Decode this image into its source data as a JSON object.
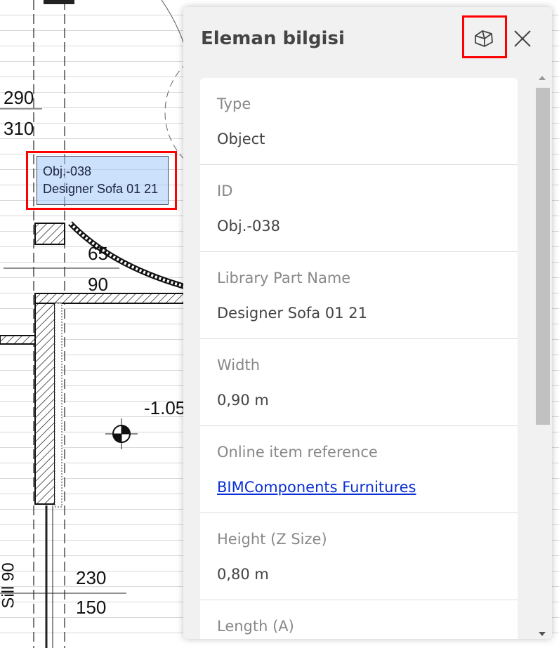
{
  "plan": {
    "dimensions": [
      "290",
      "310",
      "65",
      "90",
      "-1.05",
      "230",
      "150",
      "Sill 90"
    ],
    "selected_label": {
      "line1": "Obj.-038",
      "line2": "Designer Sofa 01 21"
    }
  },
  "panel": {
    "title": "Eleman bilgisi",
    "properties": [
      {
        "key": "Type",
        "value": "Object"
      },
      {
        "key": "ID",
        "value": "Obj.-038"
      },
      {
        "key": "Library Part Name",
        "value": "Designer Sofa 01 21"
      },
      {
        "key": "Width",
        "value": "0,90 m"
      },
      {
        "key": "Online item reference",
        "value": "BIMComponents Furnitures",
        "link": true
      },
      {
        "key": "Height (Z Size)",
        "value": "0,80 m"
      },
      {
        "key": "Length (A)",
        "value": ""
      }
    ]
  },
  "colors": {
    "highlight": "#ff0000",
    "link": "#0a2fd6",
    "selection": "#a0c8fa"
  }
}
